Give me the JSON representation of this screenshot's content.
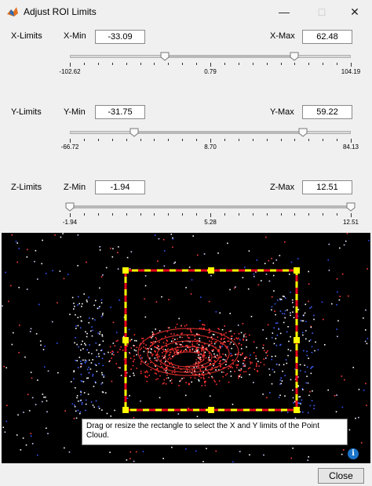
{
  "window": {
    "title": "Adjust ROI Limits",
    "minimize_icon": "minimize-icon",
    "maximize_icon": "maximize-icon",
    "close_icon": "close-icon"
  },
  "x_limits": {
    "label": "X-Limits",
    "min_label": "X-Min",
    "min_value": "-33.09",
    "max_label": "X-Max",
    "max_value": "62.48",
    "range_min": "-102.62",
    "range_mid": "0.79",
    "range_max": "104.19",
    "low_fraction": 0.337,
    "high_fraction": 0.799
  },
  "y_limits": {
    "label": "Y-Limits",
    "min_label": "Y-Min",
    "min_value": "-31.75",
    "max_label": "Y-Max",
    "max_value": "59.22",
    "range_min": "-66.72",
    "range_mid": "8.70",
    "range_max": "84.13",
    "low_fraction": 0.229,
    "high_fraction": 0.831
  },
  "z_limits": {
    "label": "Z-Limits",
    "min_label": "Z-Min",
    "min_value": "-1.94",
    "max_label": "Z-Max",
    "max_value": "12.51",
    "range_min": "-1.94",
    "range_mid": "5.28",
    "range_max": "12.51",
    "low_fraction": 0.0,
    "high_fraction": 1.0
  },
  "viewer": {
    "tooltip": "Drag or resize the rectangle to select the X and Y limits of the Point Cloud.",
    "info_icon": "info-icon",
    "info_glyph": "i",
    "roi_colors": {
      "dash_a": "#ffff00",
      "dash_b": "#e8001c",
      "handle": "#ffff00"
    }
  },
  "footer": {
    "close_label": "Close"
  }
}
